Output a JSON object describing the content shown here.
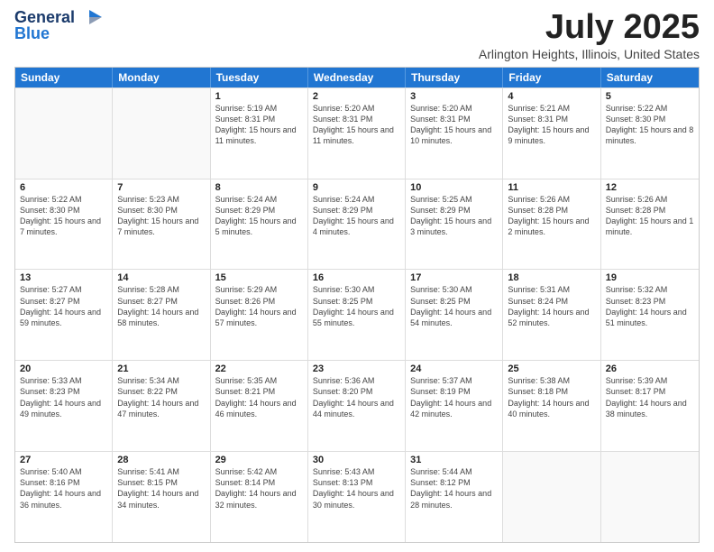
{
  "header": {
    "logo_line1": "General",
    "logo_line2": "Blue",
    "month": "July 2025",
    "location": "Arlington Heights, Illinois, United States"
  },
  "weekdays": [
    "Sunday",
    "Monday",
    "Tuesday",
    "Wednesday",
    "Thursday",
    "Friday",
    "Saturday"
  ],
  "weeks": [
    [
      {
        "day": "",
        "sunrise": "",
        "sunset": "",
        "daylight": "",
        "empty": true
      },
      {
        "day": "",
        "sunrise": "",
        "sunset": "",
        "daylight": "",
        "empty": true
      },
      {
        "day": "1",
        "sunrise": "Sunrise: 5:19 AM",
        "sunset": "Sunset: 8:31 PM",
        "daylight": "Daylight: 15 hours and 11 minutes."
      },
      {
        "day": "2",
        "sunrise": "Sunrise: 5:20 AM",
        "sunset": "Sunset: 8:31 PM",
        "daylight": "Daylight: 15 hours and 11 minutes."
      },
      {
        "day": "3",
        "sunrise": "Sunrise: 5:20 AM",
        "sunset": "Sunset: 8:31 PM",
        "daylight": "Daylight: 15 hours and 10 minutes."
      },
      {
        "day": "4",
        "sunrise": "Sunrise: 5:21 AM",
        "sunset": "Sunset: 8:31 PM",
        "daylight": "Daylight: 15 hours and 9 minutes."
      },
      {
        "day": "5",
        "sunrise": "Sunrise: 5:22 AM",
        "sunset": "Sunset: 8:30 PM",
        "daylight": "Daylight: 15 hours and 8 minutes."
      }
    ],
    [
      {
        "day": "6",
        "sunrise": "Sunrise: 5:22 AM",
        "sunset": "Sunset: 8:30 PM",
        "daylight": "Daylight: 15 hours and 7 minutes."
      },
      {
        "day": "7",
        "sunrise": "Sunrise: 5:23 AM",
        "sunset": "Sunset: 8:30 PM",
        "daylight": "Daylight: 15 hours and 7 minutes."
      },
      {
        "day": "8",
        "sunrise": "Sunrise: 5:24 AM",
        "sunset": "Sunset: 8:29 PM",
        "daylight": "Daylight: 15 hours and 5 minutes."
      },
      {
        "day": "9",
        "sunrise": "Sunrise: 5:24 AM",
        "sunset": "Sunset: 8:29 PM",
        "daylight": "Daylight: 15 hours and 4 minutes."
      },
      {
        "day": "10",
        "sunrise": "Sunrise: 5:25 AM",
        "sunset": "Sunset: 8:29 PM",
        "daylight": "Daylight: 15 hours and 3 minutes."
      },
      {
        "day": "11",
        "sunrise": "Sunrise: 5:26 AM",
        "sunset": "Sunset: 8:28 PM",
        "daylight": "Daylight: 15 hours and 2 minutes."
      },
      {
        "day": "12",
        "sunrise": "Sunrise: 5:26 AM",
        "sunset": "Sunset: 8:28 PM",
        "daylight": "Daylight: 15 hours and 1 minute."
      }
    ],
    [
      {
        "day": "13",
        "sunrise": "Sunrise: 5:27 AM",
        "sunset": "Sunset: 8:27 PM",
        "daylight": "Daylight: 14 hours and 59 minutes."
      },
      {
        "day": "14",
        "sunrise": "Sunrise: 5:28 AM",
        "sunset": "Sunset: 8:27 PM",
        "daylight": "Daylight: 14 hours and 58 minutes."
      },
      {
        "day": "15",
        "sunrise": "Sunrise: 5:29 AM",
        "sunset": "Sunset: 8:26 PM",
        "daylight": "Daylight: 14 hours and 57 minutes."
      },
      {
        "day": "16",
        "sunrise": "Sunrise: 5:30 AM",
        "sunset": "Sunset: 8:25 PM",
        "daylight": "Daylight: 14 hours and 55 minutes."
      },
      {
        "day": "17",
        "sunrise": "Sunrise: 5:30 AM",
        "sunset": "Sunset: 8:25 PM",
        "daylight": "Daylight: 14 hours and 54 minutes."
      },
      {
        "day": "18",
        "sunrise": "Sunrise: 5:31 AM",
        "sunset": "Sunset: 8:24 PM",
        "daylight": "Daylight: 14 hours and 52 minutes."
      },
      {
        "day": "19",
        "sunrise": "Sunrise: 5:32 AM",
        "sunset": "Sunset: 8:23 PM",
        "daylight": "Daylight: 14 hours and 51 minutes."
      }
    ],
    [
      {
        "day": "20",
        "sunrise": "Sunrise: 5:33 AM",
        "sunset": "Sunset: 8:23 PM",
        "daylight": "Daylight: 14 hours and 49 minutes."
      },
      {
        "day": "21",
        "sunrise": "Sunrise: 5:34 AM",
        "sunset": "Sunset: 8:22 PM",
        "daylight": "Daylight: 14 hours and 47 minutes."
      },
      {
        "day": "22",
        "sunrise": "Sunrise: 5:35 AM",
        "sunset": "Sunset: 8:21 PM",
        "daylight": "Daylight: 14 hours and 46 minutes."
      },
      {
        "day": "23",
        "sunrise": "Sunrise: 5:36 AM",
        "sunset": "Sunset: 8:20 PM",
        "daylight": "Daylight: 14 hours and 44 minutes."
      },
      {
        "day": "24",
        "sunrise": "Sunrise: 5:37 AM",
        "sunset": "Sunset: 8:19 PM",
        "daylight": "Daylight: 14 hours and 42 minutes."
      },
      {
        "day": "25",
        "sunrise": "Sunrise: 5:38 AM",
        "sunset": "Sunset: 8:18 PM",
        "daylight": "Daylight: 14 hours and 40 minutes."
      },
      {
        "day": "26",
        "sunrise": "Sunrise: 5:39 AM",
        "sunset": "Sunset: 8:17 PM",
        "daylight": "Daylight: 14 hours and 38 minutes."
      }
    ],
    [
      {
        "day": "27",
        "sunrise": "Sunrise: 5:40 AM",
        "sunset": "Sunset: 8:16 PM",
        "daylight": "Daylight: 14 hours and 36 minutes."
      },
      {
        "day": "28",
        "sunrise": "Sunrise: 5:41 AM",
        "sunset": "Sunset: 8:15 PM",
        "daylight": "Daylight: 14 hours and 34 minutes."
      },
      {
        "day": "29",
        "sunrise": "Sunrise: 5:42 AM",
        "sunset": "Sunset: 8:14 PM",
        "daylight": "Daylight: 14 hours and 32 minutes."
      },
      {
        "day": "30",
        "sunrise": "Sunrise: 5:43 AM",
        "sunset": "Sunset: 8:13 PM",
        "daylight": "Daylight: 14 hours and 30 minutes."
      },
      {
        "day": "31",
        "sunrise": "Sunrise: 5:44 AM",
        "sunset": "Sunset: 8:12 PM",
        "daylight": "Daylight: 14 hours and 28 minutes."
      },
      {
        "day": "",
        "sunrise": "",
        "sunset": "",
        "daylight": "",
        "empty": true
      },
      {
        "day": "",
        "sunrise": "",
        "sunset": "",
        "daylight": "",
        "empty": true
      }
    ]
  ]
}
